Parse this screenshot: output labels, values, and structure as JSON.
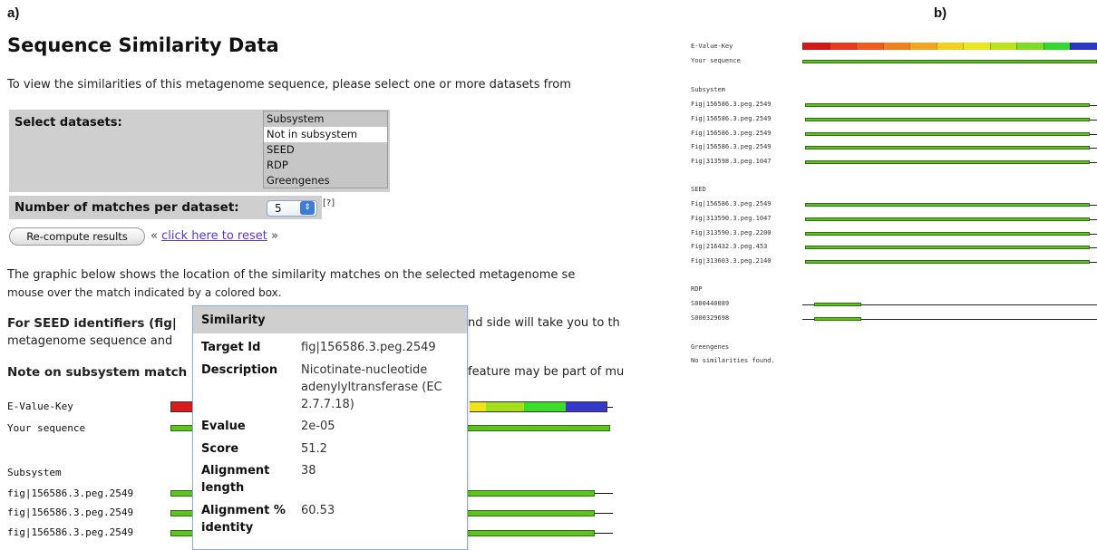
{
  "panel_a": {
    "label": "a)",
    "title": "Sequence Similarity Data",
    "intro": "To view the similarities of this metagenome sequence, please select one or more datasets from",
    "select_datasets_label": "Select datasets:",
    "datasets": [
      "Subsystem",
      "Not in subsystem",
      "SEED",
      "RDP",
      "Greengenes"
    ],
    "matches_label": "Number of matches per dataset:",
    "matches_value": "5",
    "matches_help": "[?]",
    "recompute_label": "Re-compute results",
    "reset_prefix": "«",
    "reset_link": "click here to reset",
    "reset_suffix": "»",
    "graphic_text_1": "The graphic below shows the location of the similarity matches on the selected metagenome se",
    "graphic_text_2": "mouse over the match indicated by a colored box.",
    "seed_text_left": "For SEED identifiers (fig|",
    "seed_text_right": "nd side will take you to th",
    "seed_text_2": "metagenome sequence and",
    "note_text_left": "Note on subsystem match",
    "note_text_right": "feature may be part of mu",
    "evalue_key_label": "E-Value-Key",
    "your_sequence_label": "Your sequence",
    "subsystem_label": "Subsystem",
    "rows": [
      "fig|156586.3.peg.2549",
      "fig|156586.3.peg.2549",
      "fig|156586.3.peg.2549"
    ],
    "evalue_colors": [
      "#d81b1b",
      "#f0a020",
      "#f2e21a",
      "#a4e020",
      "#3bdd2a",
      "#3838c8"
    ],
    "popup": {
      "title": "Similarity",
      "fields": [
        {
          "key": "Target Id",
          "value": "fig|156586.3.peg.2549"
        },
        {
          "key": "Description",
          "value": "Nicotinate-nucleotide adenylyltransferase (EC 2.7.7.18)"
        },
        {
          "key": "Evalue",
          "value": "2e-05"
        },
        {
          "key": "Score",
          "value": "51.2"
        },
        {
          "key": "Alignment length",
          "value": "38"
        },
        {
          "key": "Alignment % identity",
          "value": "60.53"
        }
      ]
    }
  },
  "panel_b": {
    "label": "b)",
    "evalue_key_label": "E-Value-Key",
    "your_sequence_label": "Your sequence",
    "evalue_colors": [
      "#d41818",
      "#e83820",
      "#f05a1e",
      "#f07f1c",
      "#f3a51e",
      "#f3cf1e",
      "#e8e81c",
      "#bde21e",
      "#7edc22",
      "#33d82c",
      "#2a36c4"
    ],
    "groups": [
      {
        "name": "Subsystem",
        "rows": [
          "Fig|156586.3.peg.2549",
          "Fig|156586.3.peg.2549",
          "Fig|156586.3.peg.2549",
          "Fig|156586.3.peg.2549",
          "Fig|313598.3.peg.1047"
        ]
      },
      {
        "name": "SEED",
        "rows": [
          "Fig|156586.3.peg.2549",
          "Fig|313590.3.peg.1047",
          "Fig|313590.3.peg.2200",
          "Fig|216432.3.peg.453",
          "Fig|313603.3.peg.2140"
        ]
      },
      {
        "name": "RDP",
        "rows": [
          "S000440089",
          "S000329698"
        ]
      },
      {
        "name": "Greengenes",
        "rows": []
      }
    ],
    "no_similarities": "No similarities found."
  }
}
